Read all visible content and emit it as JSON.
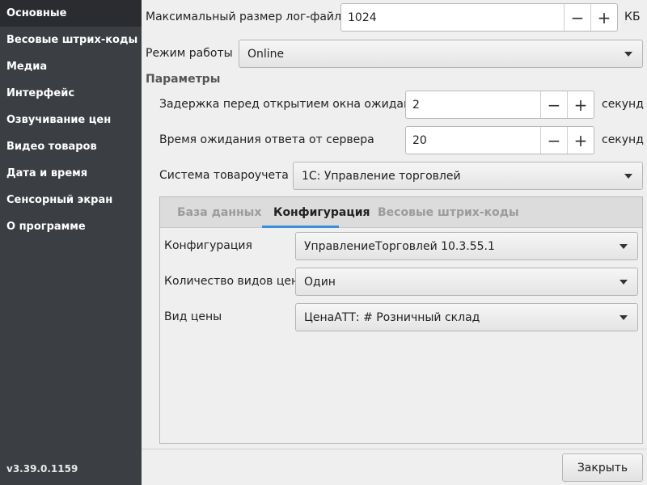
{
  "sidebar": {
    "items": [
      {
        "label": "Основные"
      },
      {
        "label": "Весовые штрих-коды"
      },
      {
        "label": "Медиа"
      },
      {
        "label": "Интерфейс"
      },
      {
        "label": "Озвучивание цен"
      },
      {
        "label": "Видео товаров"
      },
      {
        "label": "Дата и время"
      },
      {
        "label": "Сенсорный экран"
      },
      {
        "label": "О программе"
      }
    ],
    "active_index": 0,
    "version": "v3.39.0.1159"
  },
  "main": {
    "log_size": {
      "label": "Максимальный размер лог-файла",
      "value": "1024",
      "unit": "КБ",
      "minus": "−",
      "plus": "+"
    },
    "mode": {
      "label": "Режим работы",
      "value": "Online"
    },
    "params_title": "Параметры",
    "wait_delay": {
      "label": "Задержка перед открытием окна ожидания",
      "value": "2",
      "unit": "секунд",
      "minus": "−",
      "plus": "+"
    },
    "server_timeout": {
      "label": "Время ожидания ответа от сервера",
      "value": "20",
      "unit": "секунд",
      "minus": "−",
      "plus": "+"
    },
    "accounting_system": {
      "label": "Система товароучета",
      "value": "1С: Управление торговлей"
    },
    "tabs": [
      {
        "label": "База данных"
      },
      {
        "label": "Конфигурация"
      },
      {
        "label": "Весовые штрих-коды"
      }
    ],
    "active_tab": 1,
    "config": {
      "configuration": {
        "label": "Конфигурация",
        "value": "УправлениеТорговлей 10.3.55.1"
      },
      "price_types_count": {
        "label": "Количество видов цен",
        "value": "Один"
      },
      "price_type": {
        "label": "Вид цены",
        "value": "ЦенаАТТ: # Розничный склад"
      }
    },
    "close_label": "Закрыть"
  },
  "colors": {
    "sidebar_bg": "#3b3e42",
    "sidebar_active_bg": "#2a2c2f",
    "accent": "#3a8fd8",
    "window_bg": "#efefef"
  }
}
